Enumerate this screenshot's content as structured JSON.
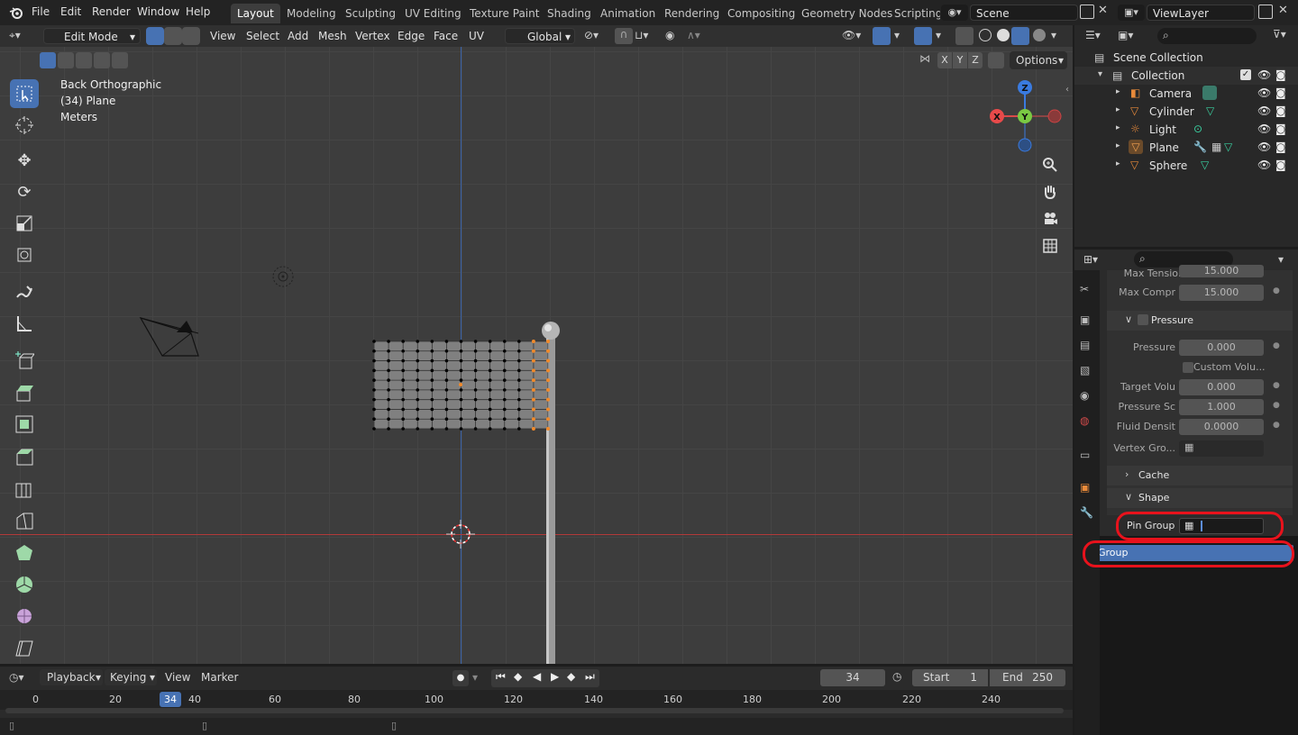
{
  "topbar": {
    "menus": [
      "File",
      "Edit",
      "Render",
      "Window",
      "Help"
    ],
    "workspace_tabs": [
      "Layout",
      "Modeling",
      "Sculpting",
      "UV Editing",
      "Texture Paint",
      "Shading",
      "Animation",
      "Rendering",
      "Compositing",
      "Geometry Nodes",
      "Scripting"
    ],
    "active_tab": "Layout",
    "scene_name": "Scene",
    "view_layer": "ViewLayer"
  },
  "viewport_header": {
    "mode": "Edit Mode",
    "menus": [
      "View",
      "Select",
      "Add",
      "Mesh",
      "Vertex",
      "Edge",
      "Face",
      "UV"
    ],
    "transform_orientation": "Global",
    "options_label": "Options",
    "axes": [
      "X",
      "Y",
      "Z"
    ]
  },
  "viewport": {
    "view_name": "Back Orthographic",
    "object_info": "(34) Plane",
    "units": "Meters",
    "gizmo": {
      "z": "Z",
      "y": "Y",
      "x": "X"
    }
  },
  "outliner": {
    "root": "Scene Collection",
    "collection": "Collection",
    "items": [
      {
        "name": "Camera"
      },
      {
        "name": "Cylinder"
      },
      {
        "name": "Light"
      },
      {
        "name": "Plane"
      },
      {
        "name": "Sphere"
      }
    ]
  },
  "properties": {
    "partial_top_label": "Max Tension",
    "partial_top_value": "15.000",
    "max_compr_label": "Max Compr",
    "max_compr_value": "15.000",
    "pressure_panel": "Pressure",
    "pressure_label": "Pressure",
    "pressure_value": "0.000",
    "custom_volume_label": "Custom Volu...",
    "target_volume_label": "Target Volu",
    "target_volume_value": "0.000",
    "pressure_scale_label": "Pressure Sc",
    "pressure_scale_value": "1.000",
    "fluid_density_label": "Fluid Densit",
    "fluid_density_value": "0.0000",
    "vertex_group_label": "Vertex Gro...",
    "cache_panel": "Cache",
    "shape_panel": "Shape",
    "pin_group_label": "Pin Group",
    "pin_group_value": "",
    "dropdown_option": "Group"
  },
  "timeline": {
    "menus": [
      "Playback",
      "Keying",
      "View",
      "Marker"
    ],
    "current_frame": "34",
    "start_label": "Start",
    "start_value": "1",
    "end_label": "End",
    "end_value": "250",
    "ruler": [
      "0",
      "20",
      "34",
      "40",
      "60",
      "80",
      "100",
      "120",
      "140",
      "160",
      "180",
      "200",
      "220",
      "240"
    ]
  },
  "colors": {
    "accent": "#4772b3",
    "highlight_circle": "#e8121c",
    "selected_vertices": "#f0892a"
  }
}
